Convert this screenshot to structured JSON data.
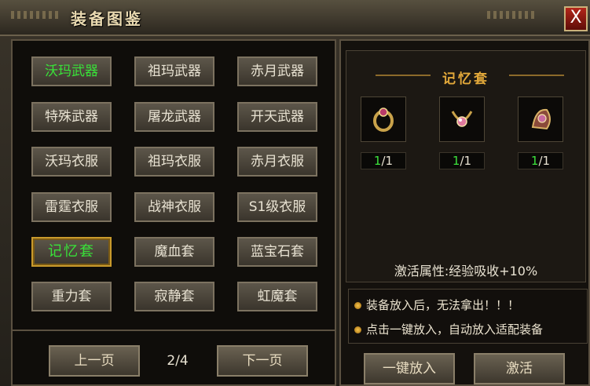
{
  "window": {
    "title": "装备图鉴",
    "close_label": "X"
  },
  "categories": [
    [
      "沃玛武器",
      "祖玛武器",
      "赤月武器"
    ],
    [
      "特殊武器",
      "屠龙武器",
      "开天武器"
    ],
    [
      "沃玛衣服",
      "祖玛衣服",
      "赤月衣服"
    ],
    [
      "雷霆衣服",
      "战神衣服",
      "S1级衣服"
    ],
    [
      "记忆套",
      "魔血套",
      "蓝宝石套"
    ],
    [
      "重力套",
      "寂静套",
      "虹魔套"
    ]
  ],
  "active_category": "沃玛武器",
  "selected_category": "记忆套",
  "pagination": {
    "prev_label": "上一页",
    "next_label": "下一页",
    "page": "2/4"
  },
  "set_panel": {
    "name": "记忆套",
    "items": [
      {
        "icon": "ring-icon",
        "have": "1",
        "total": "/1"
      },
      {
        "icon": "necklace-icon",
        "have": "1",
        "total": "/1"
      },
      {
        "icon": "bracelet-icon",
        "have": "1",
        "total": "/1"
      }
    ],
    "attribute": "激活属性:经验吸收+10%"
  },
  "tips": [
    "装备放入后，无法拿出！！！",
    "点击一键放入，自动放入适配装备"
  ],
  "actions": {
    "auto_place_label": "一键放入",
    "activate_label": "激活"
  },
  "colors": {
    "active_green": "#39e239",
    "set_gold": "#e2a83a",
    "close_red": "#b3261a"
  }
}
